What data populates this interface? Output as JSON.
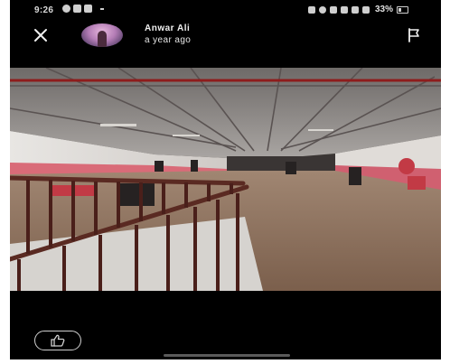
{
  "status_bar": {
    "time": "9:26",
    "battery": "33%"
  },
  "post": {
    "author_name": "Anwar Ali",
    "posted_time": "a year ago"
  },
  "icons": {
    "close": "close-icon",
    "flag": "flag-icon",
    "like": "thumbs-up-icon"
  }
}
